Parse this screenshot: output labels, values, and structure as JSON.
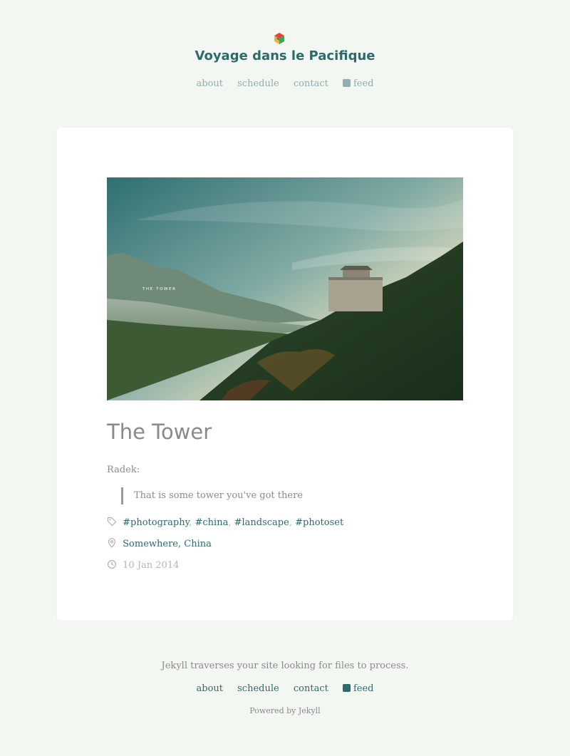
{
  "site": {
    "title": "Voyage dans le Pacifique",
    "logo_icon": "hexagon-cube-icon"
  },
  "nav": {
    "items": [
      {
        "label": "about"
      },
      {
        "label": "schedule"
      },
      {
        "label": "contact"
      },
      {
        "label": "feed",
        "icon": "rss-icon"
      }
    ]
  },
  "post": {
    "image_caption": "THE TOWER",
    "title": "The Tower",
    "speaker": "Radek:",
    "quote": "That is some tower you've got there",
    "tags": [
      "#photography",
      "#china",
      "#landscape",
      "#photoset"
    ],
    "tag_separator": ",",
    "location": "Somewhere, China",
    "date": "10 Jan 2014",
    "icons": {
      "tags": "tag-icon",
      "location": "map-pin-icon",
      "date": "clock-icon"
    }
  },
  "footer": {
    "description": "Jekyll traverses your site looking for files to process.",
    "powered": "Powered by Jekyll"
  },
  "colors": {
    "background": "#f3f7f2",
    "accent": "#2d6a6e",
    "nav_muted": "#8faeaf",
    "text": "#8a8a8a"
  }
}
